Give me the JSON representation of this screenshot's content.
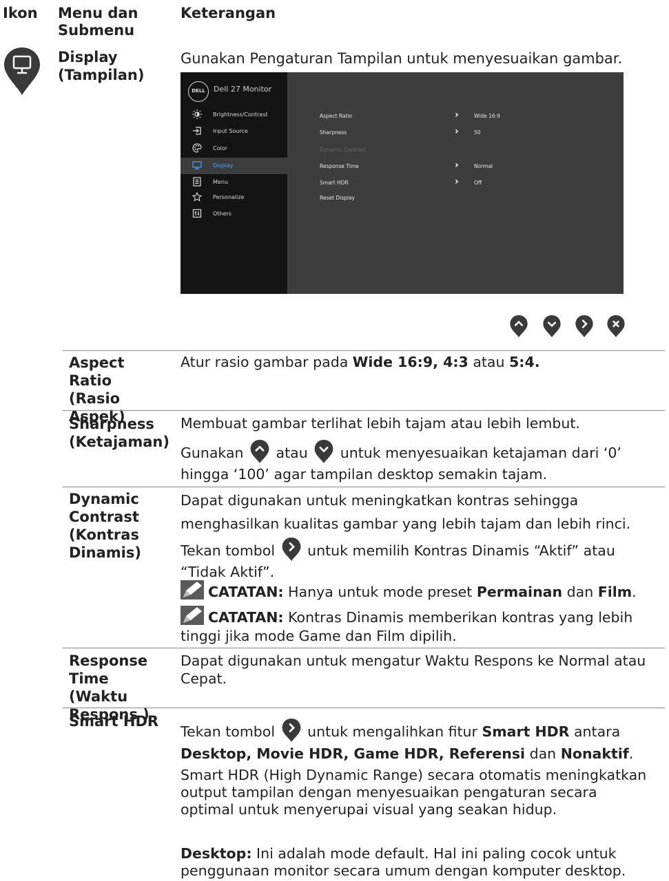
{
  "header": {
    "col_icon": "Ikon",
    "col_menu": "Menu dan Submenu",
    "col_desc": "Keterangan"
  },
  "display": {
    "name": "Display (Tampilan)",
    "desc": "Gunakan Pengaturan Tampilan untuk menyesuaikan gambar.",
    "icon": "monitor-pin-icon"
  },
  "osd": {
    "logo": "DELL",
    "title": "Dell 27 Monitor",
    "menu": [
      {
        "label": "Brightness/Contrast",
        "icon": "brightness-icon"
      },
      {
        "label": "Input Source",
        "icon": "input-source-icon"
      },
      {
        "label": "Color",
        "icon": "color-icon"
      },
      {
        "label": "Display",
        "icon": "display-icon",
        "active": true
      },
      {
        "label": "Menu",
        "icon": "menu-icon"
      },
      {
        "label": "Personalize",
        "icon": "star-icon"
      },
      {
        "label": "Others",
        "icon": "others-icon"
      }
    ],
    "rows": [
      {
        "label": "Aspect Ratio",
        "value": "Wide 16:9",
        "chevron": true
      },
      {
        "label": "Sharpness",
        "value": "50",
        "chevron": true
      },
      {
        "label": "Dynamic Contrast",
        "value": "",
        "dim": true
      },
      {
        "label": "Response Time",
        "value": "Normal",
        "chevron": true
      },
      {
        "label": "Smart HDR",
        "value": "Off",
        "chevron": true
      },
      {
        "label": "Reset Display",
        "value": ""
      }
    ]
  },
  "nav_buttons": [
    "up",
    "down",
    "right",
    "close"
  ],
  "rows": {
    "aspect": {
      "name": "Aspect Ratio (Rasio Aspek)",
      "t1": "Atur rasio gambar pada ",
      "b1": "Wide 16:9, 4:3",
      "t2": " atau ",
      "b2": "5:4."
    },
    "sharpness": {
      "name": "Sharpness (Ketajaman)",
      "l1": "Membuat gambar terlihat lebih tajam atau lebih lembut.",
      "l2a": "Gunakan ",
      "l2b": " atau ",
      "l2c": " untuk menyesuaikan ketajaman dari ‘0’",
      "l3": "hingga ‘100’ agar tampilan desktop semakin tajam."
    },
    "dynamic": {
      "name": "Dynamic Contrast (Kontras Dinamis)",
      "p1": "Dapat digunakan untuk meningkatkan kontras sehingga menghasilkan kualitas gambar yang lebih tajam dan lebih rinci.",
      "p2a": "Tekan tombol ",
      "p2b": " untuk memilih Kontras Dinamis “Aktif” atau “Tidak Aktif”.",
      "n1_label": "CATATAN:",
      "n1a": " Hanya untuk mode preset ",
      "n1b": "Permainan",
      "n1c": " dan ",
      "n1d": "Film",
      "n1e": ".",
      "n2_label": "CATATAN:",
      "n2": " Kontras Dinamis memberikan kontras yang lebih tinggi jika mode Game dan Film dipilih."
    },
    "response": {
      "name": "Response Time (Waktu Respons )",
      "desc": "Dapat digunakan untuk mengatur Waktu Respons ke Normal atau Cepat."
    },
    "smarthdr": {
      "name": "Smart HDR",
      "p1a": "Tekan tombol ",
      "p1b": " untuk mengalihkan fitur ",
      "p1c": "Smart HDR",
      "p1d": " antara ",
      "p1e": "Desktop, Movie HDR, Game HDR, Referensi",
      "p1f": " dan ",
      "p1g": "Nonaktif",
      "p1h": ".",
      "p2": "Smart HDR (High Dynamic Range) secara otomatis meningkatkan output tampilan dengan menyesuaikan pengaturan secara optimal untuk menyerupai visual yang seakan hidup.",
      "p3a": "Desktop:",
      "p3b": " Ini adalah mode default. Hal ini paling cocok untuk penggunaan monitor secara umum dengan komputer desktop."
    }
  },
  "colors": {
    "pin": "#3a3a3a",
    "osd_bg": "#3d3d3d",
    "osd_side": "#141414",
    "osd_active": "#4fa2ff",
    "rule": "#8a8a8a"
  }
}
